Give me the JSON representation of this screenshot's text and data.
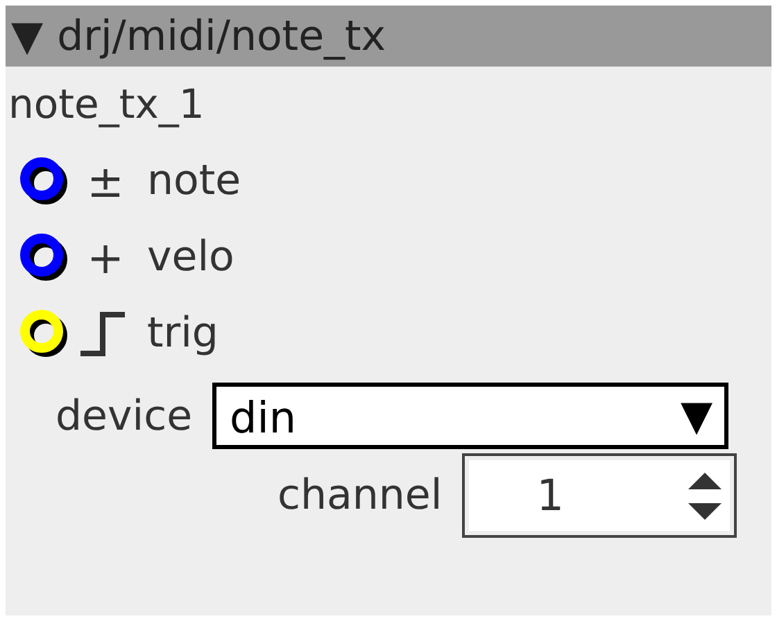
{
  "header": {
    "toggle": "▼",
    "title": "drj/midi/note_tx"
  },
  "node_name": "note_tx_1",
  "ports": [
    {
      "kind": "symbol",
      "symbol": "±",
      "name": "note",
      "color": "#0000ff"
    },
    {
      "kind": "symbol",
      "symbol": "+",
      "name": "velo",
      "color": "#0000ff"
    },
    {
      "kind": "step",
      "name": "trig",
      "color": "#ffff00"
    }
  ],
  "device": {
    "label": "device",
    "value": "din",
    "arrow": "▼"
  },
  "channel": {
    "label": "channel",
    "value": "1"
  }
}
